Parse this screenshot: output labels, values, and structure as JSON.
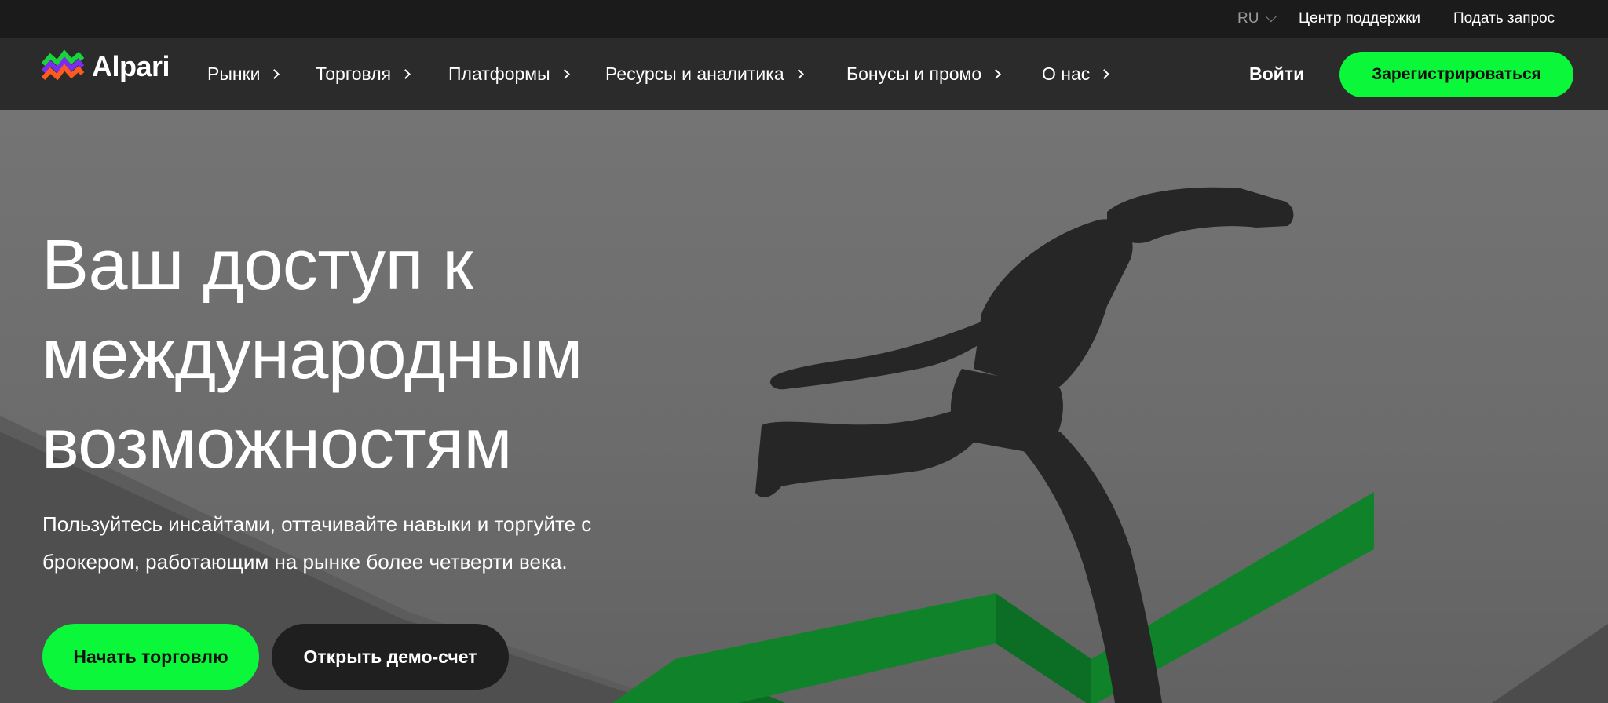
{
  "topbar": {
    "language": "RU",
    "support_link": "Центр поддержки",
    "request_link": "Подать запрос"
  },
  "navbar": {
    "logo_text": "Alpari",
    "items": [
      {
        "label": "Рынки"
      },
      {
        "label": "Торговля"
      },
      {
        "label": "Платформы"
      },
      {
        "label": "Ресурсы и аналитика"
      },
      {
        "label": "Бонусы и промо"
      },
      {
        "label": "О нас"
      }
    ],
    "login_label": "Войти",
    "register_label": "Зарегистрироваться"
  },
  "hero": {
    "headline_lines": [
      "Ваш доступ к",
      "международным",
      "возможностям"
    ],
    "subtitle_lines": [
      "Пользуйтесь инсайтами, оттачивайте навыки и торгуйте с",
      "брокером, работающим на рынке более четверти века."
    ],
    "start_button": "Начать торговлю",
    "demo_button": "Открыть демо-счет"
  },
  "colors": {
    "accent_green": "#0bf83a",
    "topbar_bg": "#1b1b1b",
    "navbar_bg": "#2b2b2b",
    "demo_button_bg": "#1f1f1f",
    "graphic_green": "#10822a"
  },
  "icons": {
    "logo": "alpari-logo-icon",
    "language_dropdown": "chevron-down-icon",
    "nav_arrow": "chevron-right-icon"
  }
}
